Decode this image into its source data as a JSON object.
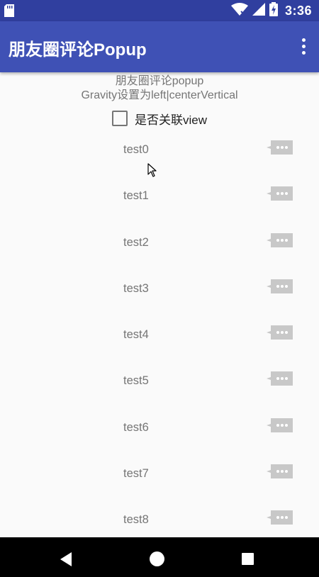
{
  "status_bar": {
    "time": "3:36",
    "icons": [
      "sd-card-icon",
      "wifi-icon",
      "signal-icon",
      "battery-charging-icon"
    ]
  },
  "app_bar": {
    "title": "朋友圈评论Popup",
    "overflow_icon": "more-vert-icon"
  },
  "description": {
    "line1": "朋友圈评论popup",
    "line2": "Gravity设置为left|centerVertical"
  },
  "checkbox": {
    "label": "是否关联view",
    "checked": false
  },
  "list": {
    "items": [
      {
        "label": "test0"
      },
      {
        "label": "test1"
      },
      {
        "label": "test2"
      },
      {
        "label": "test3"
      },
      {
        "label": "test4"
      },
      {
        "label": "test5"
      },
      {
        "label": "test6"
      },
      {
        "label": "test7"
      },
      {
        "label": "test8"
      }
    ],
    "action_icon": "comment-more-icon"
  },
  "nav_bar": {
    "icons": [
      "back-icon",
      "home-icon",
      "recents-icon"
    ]
  },
  "colors": {
    "status_bar": "#303f9f",
    "app_bar": "#3f51b5",
    "background": "#fafafa",
    "secondary_text": "#757575",
    "action_icon": "#bdbdbd"
  }
}
